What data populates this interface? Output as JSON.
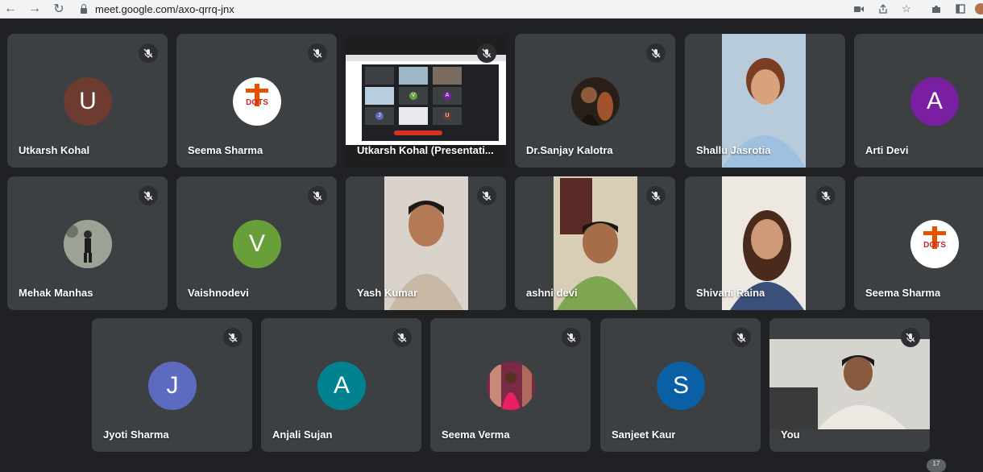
{
  "browser": {
    "url": "meet.google.com/axo-qrrq-jnx",
    "icons": [
      "back-icon",
      "forward-icon",
      "reload-icon",
      "lock-icon",
      "camera-icon",
      "share-icon",
      "star-icon",
      "extensions-icon",
      "sidebar-icon",
      "profile-avatar"
    ]
  },
  "participants": [
    {
      "name": "Utkarsh Kohal",
      "type": "initial",
      "initial": "U",
      "color": "#6d3b30"
    },
    {
      "name": "Seema Sharma",
      "type": "logo",
      "logo_text": "DOTS"
    },
    {
      "name": "Utkarsh Kohal (Presentati...",
      "type": "presentation"
    },
    {
      "name": "Dr.Sanjay Kalotra",
      "type": "photo",
      "color": "#3a2a20"
    },
    {
      "name": "Shallu Jasrotia",
      "type": "video",
      "color": "#b9cfe0"
    },
    {
      "name": "Arti Devi",
      "type": "initial",
      "initial": "A",
      "color": "#7b1fa2"
    },
    {
      "name": "Mehak Manhas",
      "type": "photo",
      "color": "#8a8f86"
    },
    {
      "name": "Vaishnodevi",
      "type": "initial",
      "initial": "V",
      "color": "#689f38"
    },
    {
      "name": "Yash Kumar",
      "type": "video",
      "color": "#d6cfc6"
    },
    {
      "name": "ashni devi",
      "type": "video",
      "color": "#c9b99a"
    },
    {
      "name": "Shivani Raina",
      "type": "video",
      "color": "#e8e2dc"
    },
    {
      "name": "Seema Sharma",
      "type": "logo",
      "logo_text": "DOTS"
    },
    {
      "name": "Jyoti Sharma",
      "type": "initial",
      "initial": "J",
      "color": "#5c6bc0"
    },
    {
      "name": "Anjali Sujan",
      "type": "initial",
      "initial": "A",
      "color": "#00838f"
    },
    {
      "name": "Seema Verma",
      "type": "photo",
      "color": "#c2185b"
    },
    {
      "name": "Sanjeet Kaur",
      "type": "initial",
      "initial": "S",
      "color": "#0b5fa5"
    },
    {
      "name": "You",
      "type": "video",
      "color": "#d9d9d4"
    }
  ],
  "presentation_thumb_initials": [
    "V",
    "A",
    "J",
    "U"
  ],
  "bottom_badge": "17"
}
